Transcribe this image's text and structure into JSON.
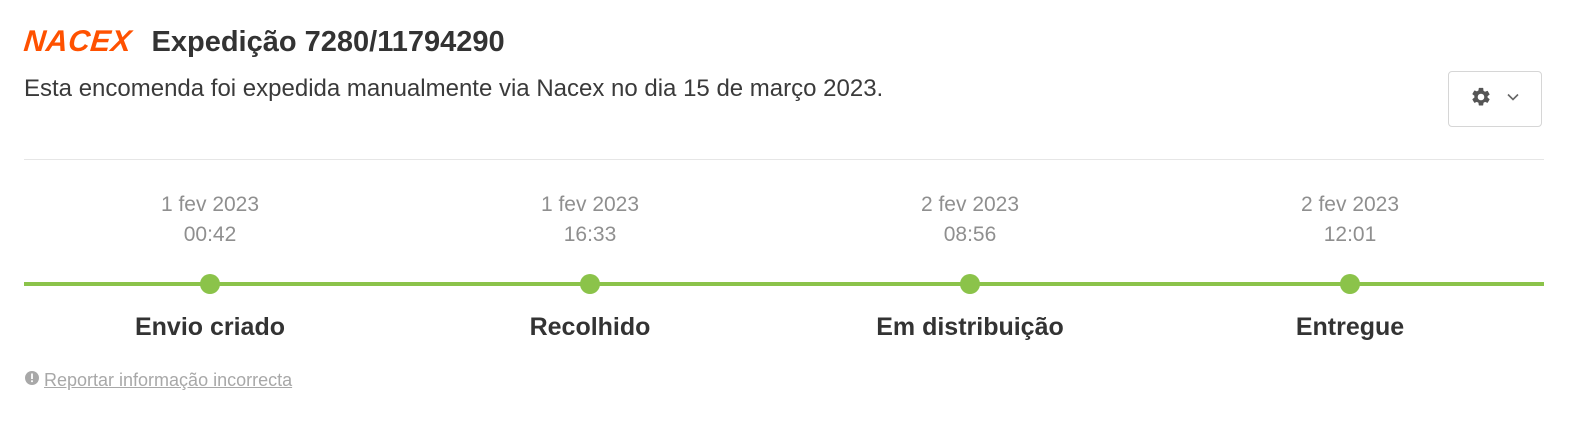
{
  "header": {
    "logo_text": "NACEX",
    "title": "Expedição 7280/11794290",
    "brand_color": "#ff5100"
  },
  "description": "Esta encomenda foi expedida manualmente via Nacex no dia 15 de março 2023.",
  "settings_button": {
    "icon": "gear-icon",
    "dropdown_icon": "chevron-down-icon"
  },
  "timeline": {
    "color": "#8bc34a",
    "steps": [
      {
        "date": "1 fev 2023",
        "time": "00:42",
        "label": "Envio criado"
      },
      {
        "date": "1 fev 2023",
        "time": "16:33",
        "label": "Recolhido"
      },
      {
        "date": "2 fev 2023",
        "time": "08:56",
        "label": "Em distribuição"
      },
      {
        "date": "2 fev 2023",
        "time": "12:01",
        "label": "Entregue"
      }
    ]
  },
  "report_link": {
    "icon": "info-circle-icon",
    "text": "Reportar informação incorrecta"
  }
}
